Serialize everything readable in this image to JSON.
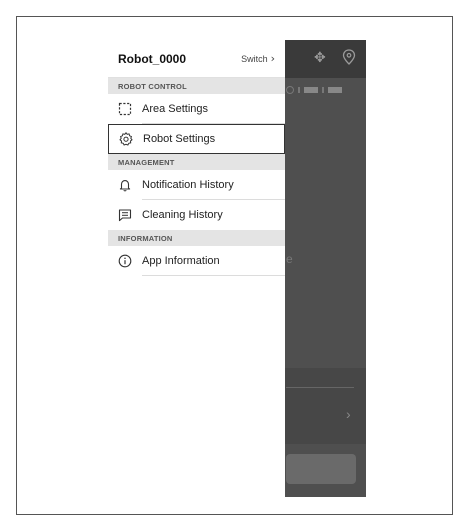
{
  "drawer": {
    "robot_name": "Robot_0000",
    "switch_label": "Switch",
    "sections": [
      {
        "title": "ROBOT CONTROL",
        "items": [
          {
            "label": "Area Settings",
            "icon": "area-icon"
          },
          {
            "label": "Robot Settings",
            "icon": "gear-icon",
            "selected": true
          }
        ]
      },
      {
        "title": "MANAGEMENT",
        "items": [
          {
            "label": "Notification History",
            "icon": "bell-icon"
          },
          {
            "label": "Cleaning History",
            "icon": "document-icon"
          }
        ]
      },
      {
        "title": "INFORMATION",
        "items": [
          {
            "label": "App Information",
            "icon": "info-icon"
          }
        ]
      }
    ]
  },
  "background": {
    "partial_text": "e"
  },
  "colors": {
    "drawer_bg": "#ffffff",
    "section_bg": "#e4e4e4",
    "dim_overlay": "#4f4f4f"
  }
}
